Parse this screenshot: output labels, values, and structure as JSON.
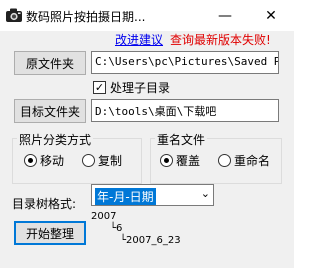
{
  "window": {
    "title": "数码照片按拍摄日期...",
    "minimize": "—",
    "close": "✕"
  },
  "links": {
    "feedback": "改进建议",
    "check_update": "查询最新版本失败!"
  },
  "source": {
    "button": "原文件夹",
    "path": "C:\\Users\\pc\\Pictures\\Saved Pic"
  },
  "subdir": {
    "label": "处理子目录",
    "checked": true
  },
  "target": {
    "button": "目标文件夹",
    "path": "D:\\tools\\桌面\\下载吧"
  },
  "classify": {
    "title": "照片分类方式",
    "options": [
      "移动",
      "复制"
    ],
    "selected": "移动"
  },
  "rename": {
    "title": "重名文件",
    "options": [
      "覆盖",
      "重命名"
    ],
    "selected": "覆盖"
  },
  "dir_format": {
    "label": "目录树格式:",
    "value": "年-月-日期"
  },
  "tree_preview": {
    "line1": "2007",
    "line2": "└6",
    "line3": "└2007_6_23"
  },
  "start": {
    "button": "开始整理"
  },
  "colors": {
    "link": "#0000ee",
    "error": "#e00000",
    "select_bg": "#0078d7"
  }
}
